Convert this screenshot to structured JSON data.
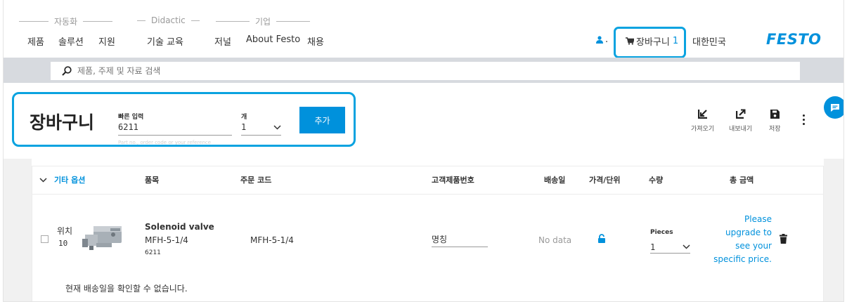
{
  "header": {
    "categories": [
      {
        "label": "자동화"
      },
      {
        "label": "Didactic"
      },
      {
        "label": "기업"
      }
    ],
    "nav_items": [
      "제품",
      "솔루션",
      "지원",
      "기술 교육",
      "저널",
      "About Festo",
      "채용"
    ],
    "user_suffix": ".",
    "cart_label": "장바구니",
    "cart_count": "1",
    "region": "대한민국",
    "logo": "FESTO"
  },
  "search": {
    "placeholder": "제품, 주제 및 자료 검색"
  },
  "cart": {
    "title": "장바구니",
    "quick_entry": {
      "label": "빠른 입력",
      "value": "6211",
      "hint": "Part no., order code or your reference"
    },
    "qty": {
      "label": "개",
      "value": "1"
    },
    "add_button": "추가",
    "tools": {
      "import": "가져오기",
      "export": "내보내기",
      "save": "저장"
    }
  },
  "table": {
    "headers": {
      "options": "기타 옵션",
      "item": "품목",
      "order_code": "주문 코드",
      "customer_no": "고객제품번호",
      "delivery": "배송일",
      "price_unit": "가격/단위",
      "quantity": "수량",
      "total": "총 금액"
    },
    "rows": [
      {
        "position_label": "위치",
        "position": "10",
        "name": "Solenoid valve",
        "model": "MFH-5-1/4",
        "part_no": "6211",
        "order_code": "MFH-5-1/4",
        "customer_placeholder": "명칭",
        "delivery": "No data",
        "unit": "Pieces",
        "qty": "1",
        "price_line1": "Please",
        "price_line2": "upgrade to",
        "price_line3": "see your",
        "price_line4": "specific price."
      }
    ],
    "delivery_notice": "현재 배송일을 확인할 수 없습니다."
  },
  "colors": {
    "brand_blue": "#0091dc",
    "highlight": "#0aa3e0",
    "search_band": "#d7dadf"
  }
}
